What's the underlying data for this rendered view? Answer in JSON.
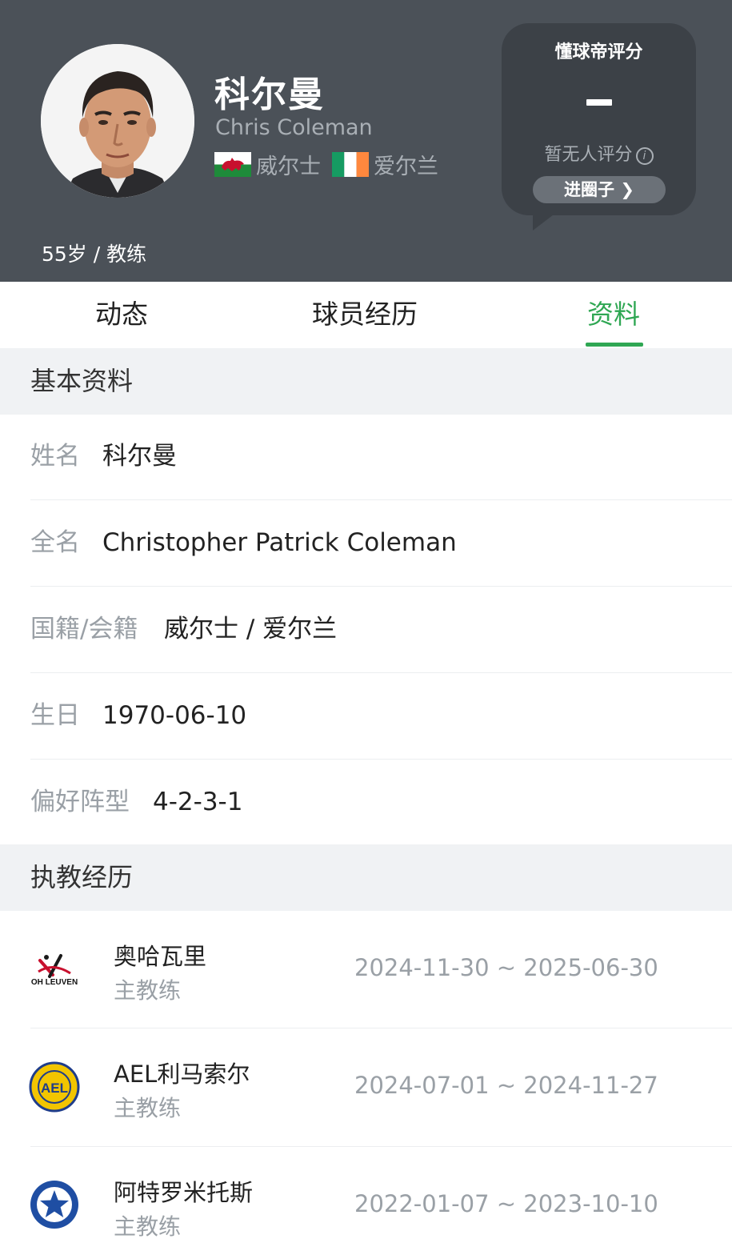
{
  "header": {
    "name_cn": "科尔曼",
    "name_en": "Chris Coleman",
    "nationalities": [
      {
        "flag": "wales-flag-icon",
        "name": "威尔士"
      },
      {
        "flag": "ireland-flag-icon",
        "name": "爱尔兰"
      }
    ],
    "age_role": "55岁 / 教练"
  },
  "rating": {
    "title": "懂球帝评分",
    "score": "-",
    "subtitle": "暂无人评分",
    "button_label": "进圈子"
  },
  "tabs": [
    {
      "label": "动态",
      "active": false
    },
    {
      "label": "球员经历",
      "active": false
    },
    {
      "label": "资料",
      "active": true
    }
  ],
  "basic_info": {
    "title": "基本资料",
    "rows": [
      {
        "label": "姓名",
        "value": "科尔曼"
      },
      {
        "label": "全名",
        "value": "Christopher Patrick Coleman"
      },
      {
        "label": "国籍/会籍",
        "value": "威尔士 / 爱尔兰"
      },
      {
        "label": "生日",
        "value": "1970-06-10"
      },
      {
        "label": "偏好阵型",
        "value": "4-2-3-1"
      }
    ]
  },
  "coaching": {
    "title": "执教经历",
    "items": [
      {
        "club": "奥哈瓦里",
        "role": "主教练",
        "dates": "2024-11-30 ~ 2025-06-30",
        "logo_text": "OH LEUVEN"
      },
      {
        "club": "AEL利马索尔",
        "role": "主教练",
        "dates": "2024-07-01 ~ 2024-11-27",
        "logo_text": "AEL"
      },
      {
        "club": "阿特罗米托斯",
        "role": "主教练",
        "dates": "2022-01-07 ~ 2023-10-10",
        "logo_text": ""
      }
    ]
  },
  "colors": {
    "header_bg": "#4b5158",
    "accent_green": "#2fa753",
    "section_bg": "#f0f2f4"
  }
}
